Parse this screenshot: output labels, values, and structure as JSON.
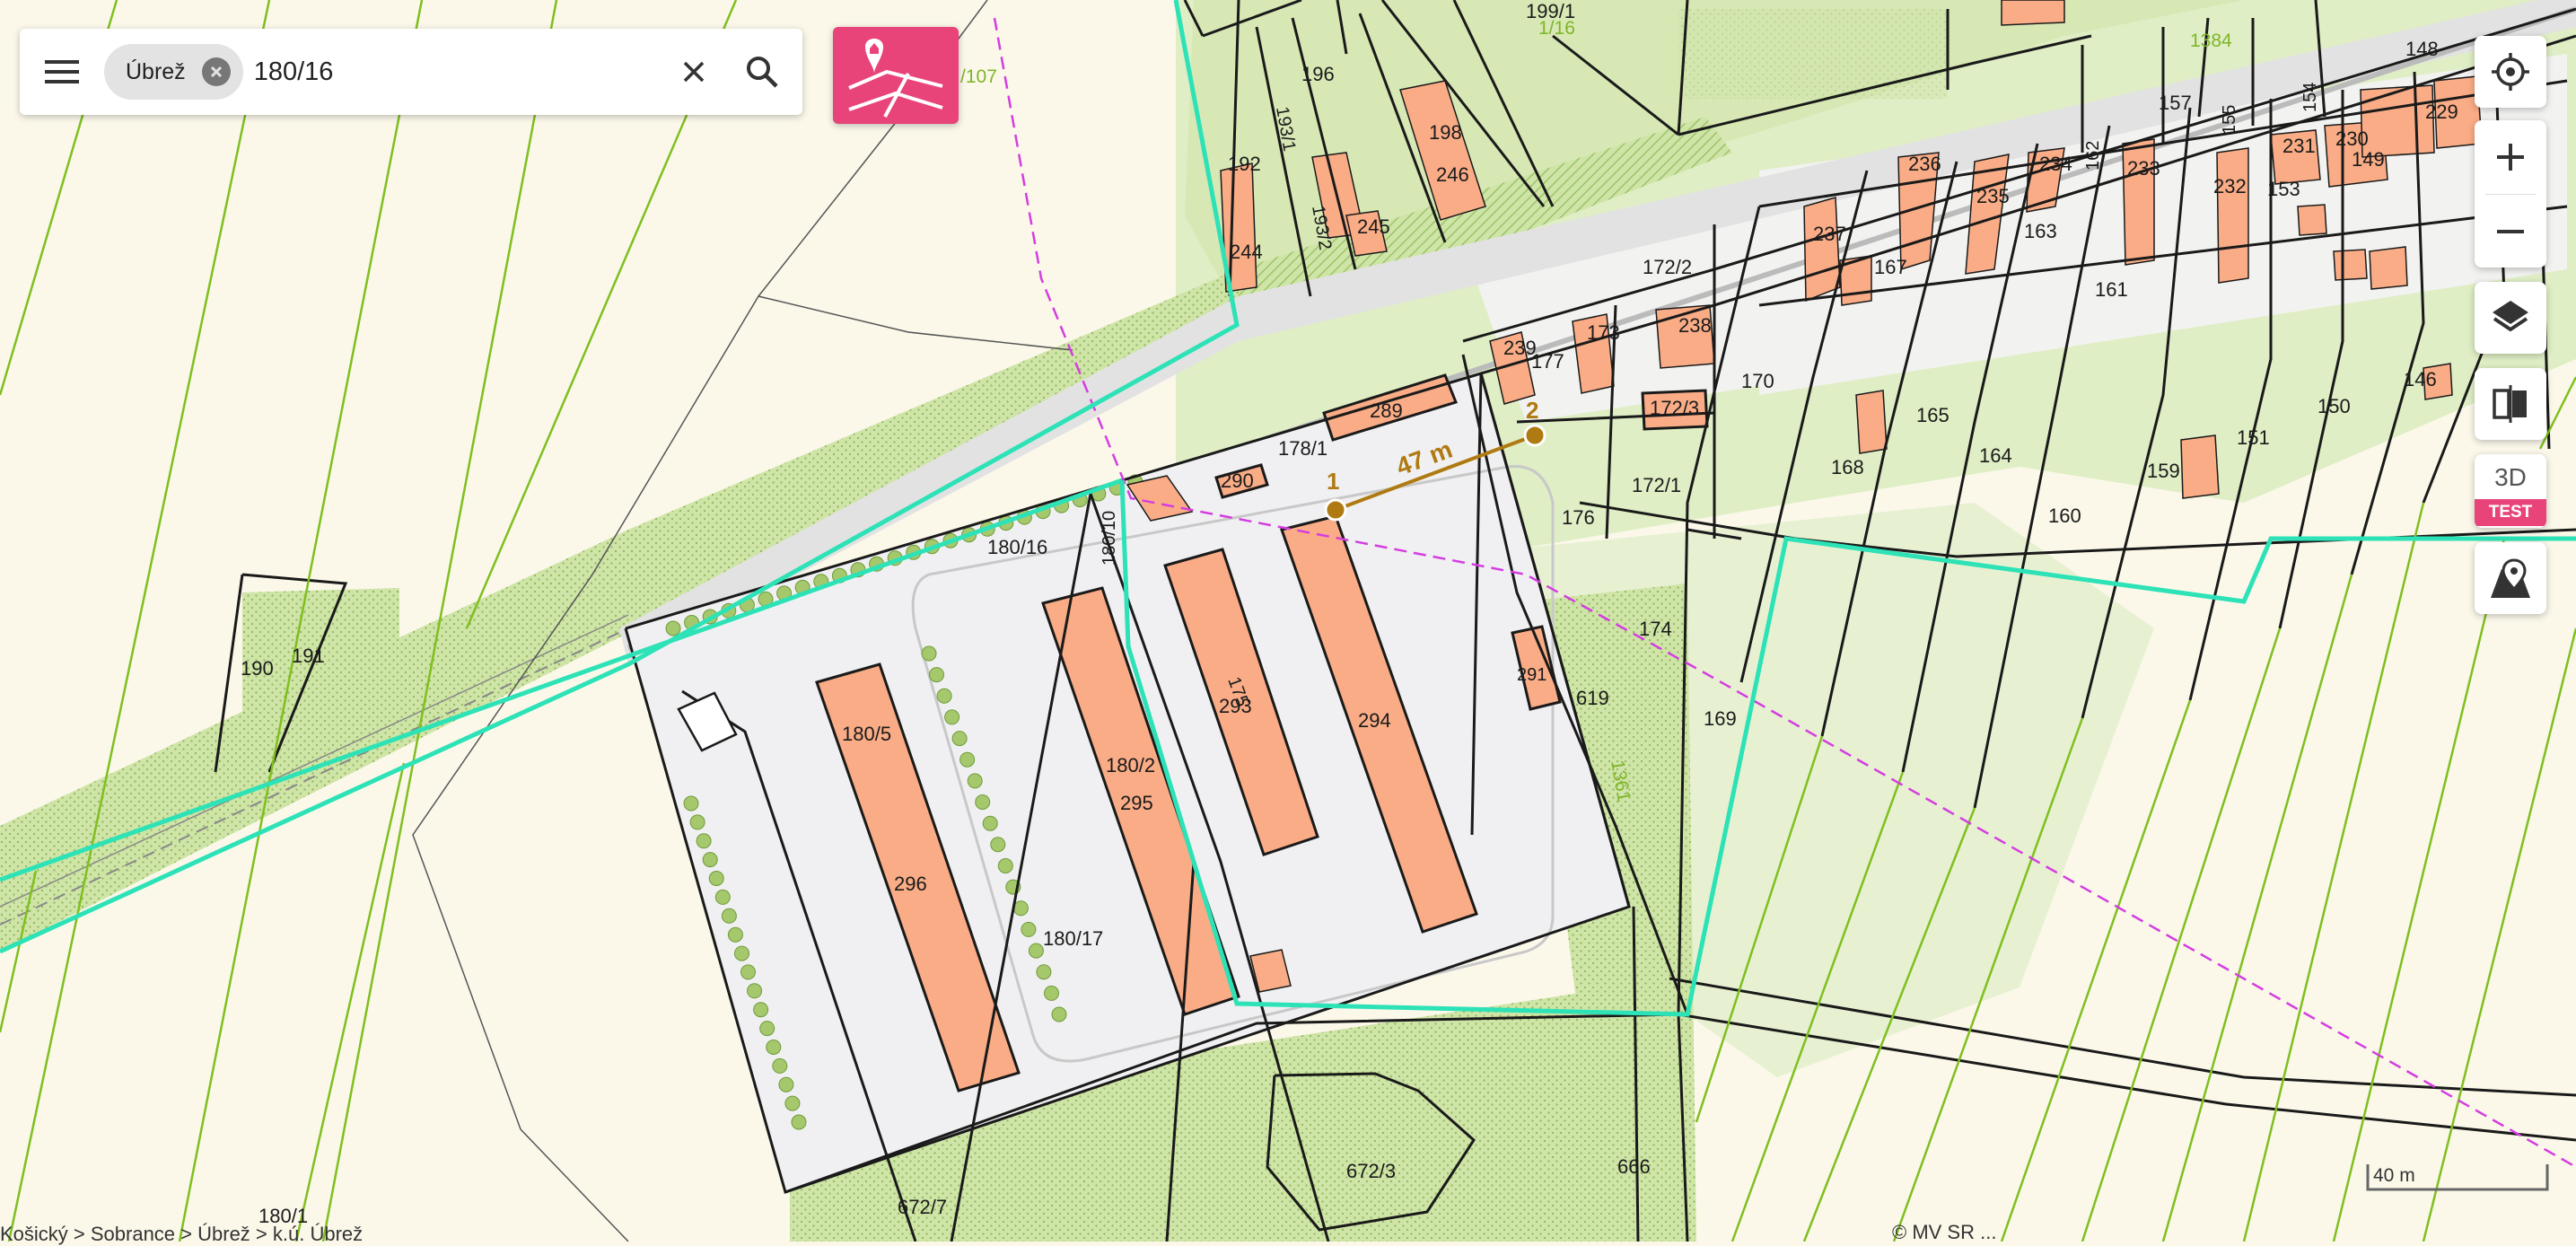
{
  "search": {
    "chip_label": "Úbrež",
    "query": "180/16"
  },
  "measurement": {
    "distance": "47 m",
    "point1": "1",
    "point2": "2"
  },
  "map_labels": {
    "p190": "190",
    "p191": "191",
    "p180_5": "180/5",
    "p296": "296",
    "p180_16": "180/16",
    "p180_10": "180/10",
    "p180_2": "180/2",
    "p295": "295",
    "p180_17": "180/17",
    "p293": "293",
    "p175": "175",
    "p294": "294",
    "p177": "177",
    "p290": "290",
    "p289": "289",
    "p178_1": "178/1",
    "p176": "176",
    "p172_1": "172/1",
    "p172_3": "172/3",
    "p174": "174",
    "p291": "291",
    "p619": "619",
    "p169": "169",
    "p170": "170",
    "p173": "173",
    "p238": "238",
    "p239": "239",
    "p172_2": "172/2",
    "p237": "237",
    "p167": "167",
    "p236": "236",
    "p235": "235",
    "p234": "234",
    "p163": "163",
    "p162": "162",
    "p233": "233",
    "p232": "232",
    "p153": "153",
    "p231": "231",
    "p230": "230",
    "p149": "149",
    "p229": "229",
    "p148": "148",
    "p157": "157",
    "p155": "155",
    "p154": "154",
    "p161": "161",
    "p165": "165",
    "p164": "164",
    "p168": "168",
    "p160": "160",
    "p159": "159",
    "p151": "151",
    "p150": "150",
    "p146": "146",
    "p192": "192",
    "p244": "244",
    "p196": "196",
    "p193_1": "193/1",
    "p193_2": "193/2",
    "p245": "245",
    "p198": "198",
    "p246": "246",
    "p199_1": "199/1",
    "p1_16": "1/16",
    "p107": "/107",
    "p1384": "1384",
    "p1361": "1361",
    "p672_3": "672/3",
    "p672_7": "672/7",
    "p666": "666",
    "p180_1": "180/1"
  },
  "controls": {
    "btn_3d": "3D",
    "test_badge": "TEST"
  },
  "footer": {
    "scale": "40 m",
    "breadcrumb": "Košický > Sobrance > Úbrež > k.ú. Úbrež",
    "copyright": "© MV SR ..."
  },
  "colors": {
    "parcel_boundary": "#1a1a1a",
    "highlight": "#2de2b6",
    "building": "#f9ac86",
    "vegetation": "#cfe4a7",
    "accent": "#e8447a",
    "measure": "#b07a12",
    "cadastre_line": "#d43ee0"
  }
}
